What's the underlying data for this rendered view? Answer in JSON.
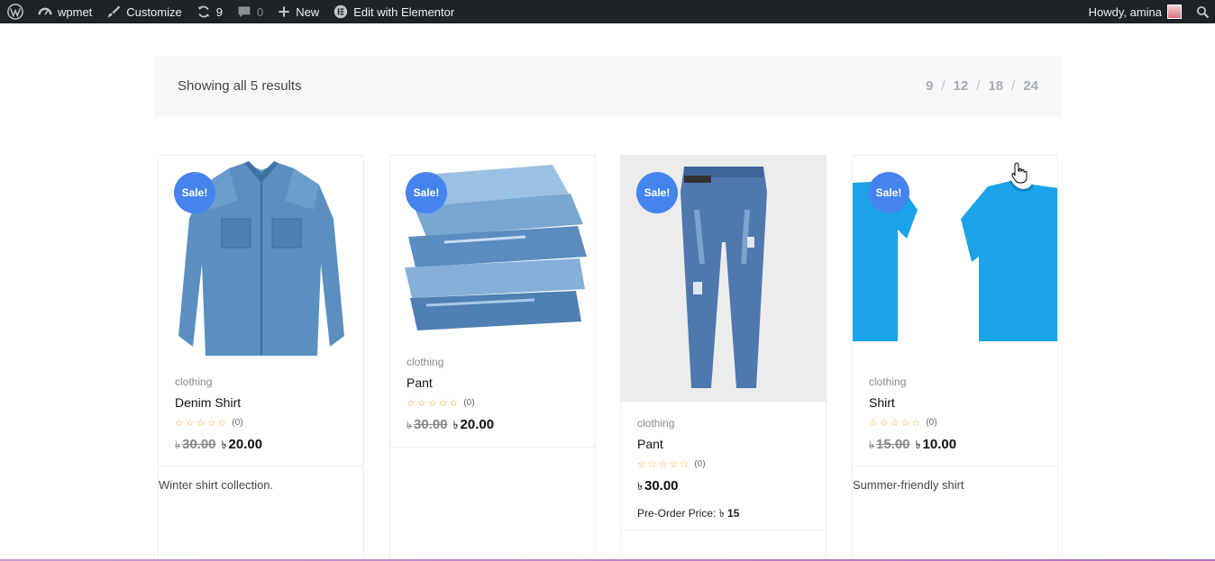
{
  "adminbar": {
    "site_name": "wpmet",
    "customize": "Customize",
    "updates_count": "9",
    "comments_count": "0",
    "new_label": "New",
    "elementor_label": "Edit with Elementor",
    "howdy": "Howdy, amina"
  },
  "toolbar": {
    "result_count": "Showing all 5 results",
    "per_page_options": [
      "9",
      "12",
      "18",
      "24"
    ],
    "separator": "/"
  },
  "products": [
    {
      "sale_badge": "Sale!",
      "category": "clothing",
      "name": "Denim Shirt",
      "stars": "☆☆☆☆☆",
      "rating_count": "(0)",
      "currency": "৳",
      "old_price": "30.00",
      "price": "20.00",
      "description": "Winter shirt collection."
    },
    {
      "sale_badge": "Sale!",
      "category": "clothing",
      "name": "Pant",
      "stars": "☆☆☆☆☆",
      "rating_count": "(0)",
      "currency": "৳",
      "old_price": "30.00",
      "price": "20.00"
    },
    {
      "sale_badge": "Sale!",
      "category": "clothing",
      "name": "Pant",
      "stars": "☆☆☆☆☆",
      "rating_count": "(0)",
      "currency": "৳",
      "price": "30.00",
      "preorder_label": "Pre-Order Price:",
      "preorder_price": "15"
    },
    {
      "sale_badge": "Sale!",
      "category": "clothing",
      "name": "Shirt",
      "stars": "☆☆☆☆☆",
      "rating_count": "(0)",
      "currency": "৳",
      "old_price": "15.00",
      "price": "10.00",
      "description": "Summer-friendly shirt"
    }
  ],
  "colors": {
    "adminbar_bg": "#1d2327",
    "sale_badge": "#4584ee",
    "star": "#f5a623"
  }
}
